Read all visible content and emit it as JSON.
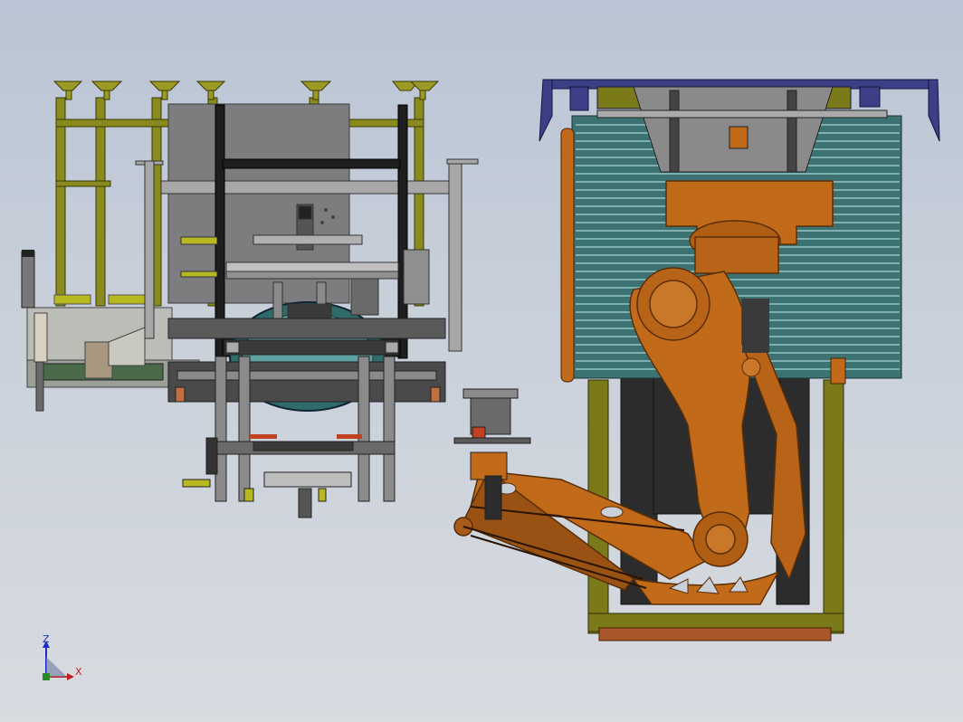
{
  "viewport": {
    "background_top": "#b9c4d4",
    "background_bottom": "#d8dbe0"
  },
  "triad": {
    "axis_z_label": "Z",
    "axis_x_label": "X",
    "z_color": "#1a2fc0",
    "x_color": "#c02020",
    "origin_color": "#2a8a2a"
  },
  "colors": {
    "olive_frame": "#8a8a1e",
    "olive_dark": "#5e5e10",
    "robot_orange": "#c06a1a",
    "robot_orange_light": "#d88a3a",
    "robot_outline": "#5a2e08",
    "teal_stack": "#4f8f8f",
    "teal_light": "#9fc8c8",
    "steel_gray": "#8a8a8a",
    "steel_dark": "#3a3a3a",
    "navy_rail": "#3a3f86",
    "copper_base": "#a8582a"
  },
  "icons": {
    "machine_left": "cell-assembly-machine",
    "robot_right": "palletizing-robot",
    "triad": "coordinate-triad"
  }
}
